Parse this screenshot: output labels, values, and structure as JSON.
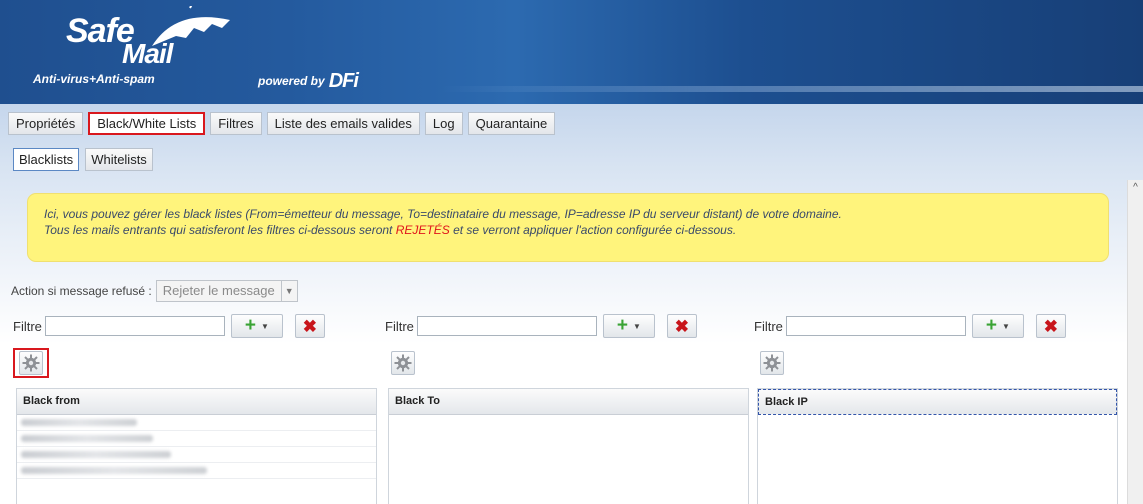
{
  "header": {
    "logo_line1": "Safe",
    "logo_line2": "Mail",
    "tagline": "Anti-virus+Anti-spam",
    "powered_by": "powered by",
    "powered_brand": "DFi"
  },
  "tabs": [
    {
      "label": "Propriétés",
      "active": false
    },
    {
      "label": "Black/White Lists",
      "active": true
    },
    {
      "label": "Filtres",
      "active": false
    },
    {
      "label": "Liste des emails valides",
      "active": false
    },
    {
      "label": "Log",
      "active": false
    },
    {
      "label": "Quarantaine",
      "active": false
    }
  ],
  "subtabs": [
    {
      "label": "Blacklists",
      "active": true
    },
    {
      "label": "Whitelists",
      "active": false
    }
  ],
  "info": {
    "line1": "Ici, vous pouvez gérer les black listes (From=émetteur du message, To=destinataire du message, IP=adresse IP du serveur distant) de votre domaine.",
    "line2_before": "Tous les mails entrants qui satisferont les filtres ci-dessous seront",
    "line2_highlight": "REJETÉS",
    "line2_after": "et se verront appliquer l'action configurée ci-dessous.",
    "highlight_color": "#e0141b"
  },
  "action": {
    "label": "Action si message refusé :",
    "selected": "Rejeter le message"
  },
  "panels": [
    {
      "filter_label": "Filtre",
      "filter_value": "",
      "column_header": "Black from",
      "rows": 4,
      "gear_highlighted": true,
      "focused": false
    },
    {
      "filter_label": "Filtre",
      "filter_value": "",
      "column_header": "Black To",
      "rows": 0,
      "gear_highlighted": false,
      "focused": false
    },
    {
      "filter_label": "Filtre",
      "filter_value": "",
      "column_header": "Black IP",
      "rows": 0,
      "gear_highlighted": false,
      "focused": true
    }
  ],
  "icons": {
    "add": "plus-icon",
    "delete": "close-icon",
    "settings": "gear-icon",
    "dropdown": "chevron-down-icon"
  },
  "colors": {
    "header_blue": "#245a9e",
    "highlight_red": "#d9181e",
    "info_yellow": "#fff47c",
    "add_green": "#3aa335",
    "delete_red": "#c8151b"
  }
}
